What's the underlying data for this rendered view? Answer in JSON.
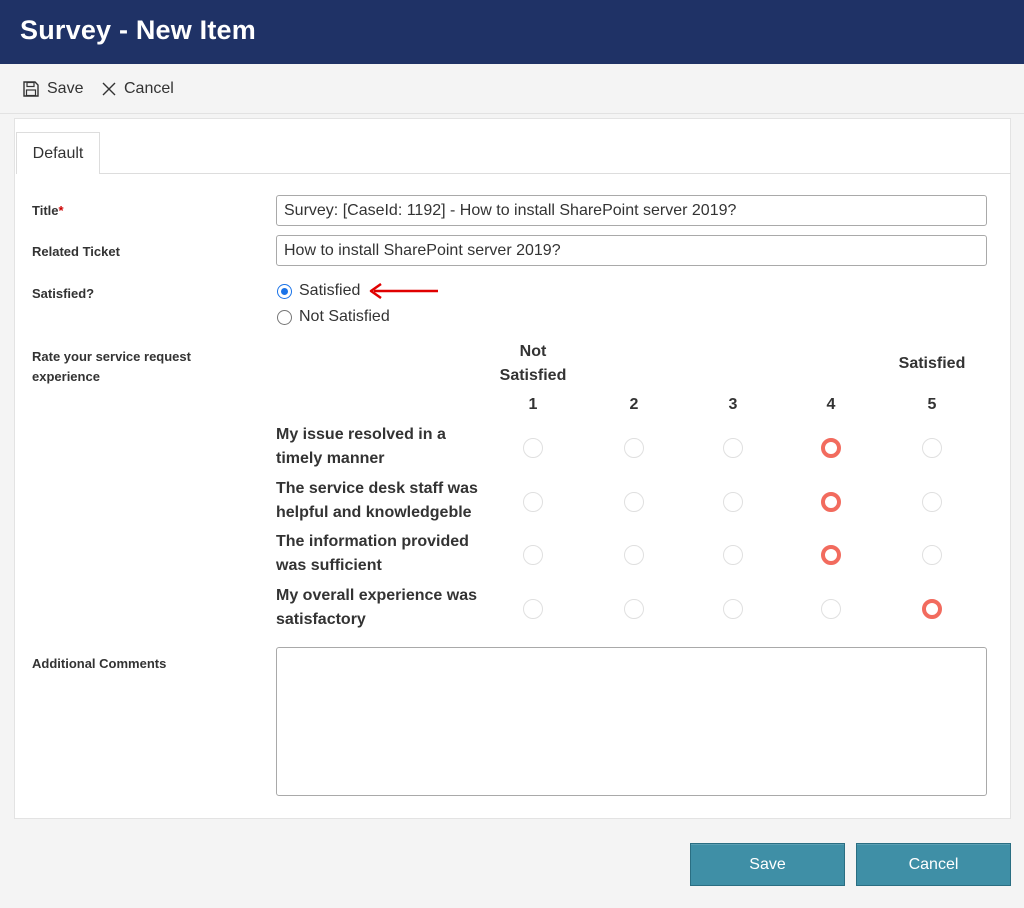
{
  "header": {
    "title": "Survey - New Item"
  },
  "toolbar": {
    "save_label": "Save",
    "cancel_label": "Cancel"
  },
  "tab": {
    "label": "Default"
  },
  "fields": {
    "title_label": "Title",
    "title_required": "*",
    "title_value": "Survey: [CaseId: 1192] - How to install SharePoint server 2019?",
    "related_label": "Related Ticket",
    "related_value": "How to install SharePoint server 2019?",
    "satisfied_label": "Satisfied?",
    "satisfied_options": [
      "Satisfied",
      "Not Satisfied"
    ],
    "satisfied_selected": "Satisfied",
    "rate_label_line1": "Rate your service request",
    "rate_label_line2": "experience",
    "comments_label": "Additional Comments",
    "comments_value": ""
  },
  "rating": {
    "low_label_line1": "Not",
    "low_label_line2": "Satisfied",
    "high_label": "Satisfied",
    "columns": [
      "1",
      "2",
      "3",
      "4",
      "5"
    ],
    "questions": [
      {
        "line1": "My issue resolved in a",
        "line2": "timely manner",
        "selected": 4
      },
      {
        "line1": "The service desk staff was",
        "line2": "helpful and knowledgeble",
        "selected": 4
      },
      {
        "line1": "The information provided",
        "line2": "was sufficient",
        "selected": 4
      },
      {
        "line1": "My overall experience was",
        "line2": "satisfactory",
        "selected": 5
      }
    ]
  },
  "buttons": {
    "save": "Save",
    "cancel": "Cancel"
  },
  "colors": {
    "header_bg": "#1f3266",
    "button_bg": "#3f8fa6",
    "selected_rating": "#f26b5e",
    "radio_checked": "#1a73e8",
    "annotation_arrow": "#e00000"
  },
  "icons": {
    "save": "floppy-disk-icon",
    "cancel": "close-icon",
    "annotation": "red-arrow-icon"
  }
}
